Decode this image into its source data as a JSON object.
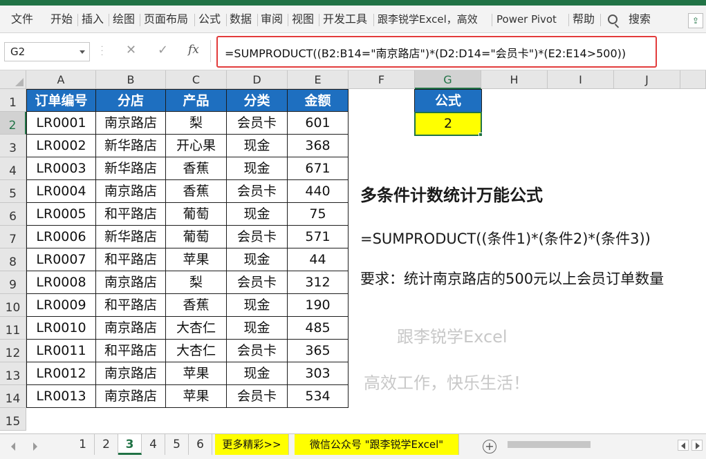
{
  "ribbon": {
    "tabs": [
      "文件",
      "开始",
      "插入",
      "绘图",
      "页面布局",
      "公式",
      "数据",
      "审阅",
      "视图",
      "开发工具",
      "跟李锐学Excel，高效",
      "Power Pivot",
      "帮助"
    ],
    "search_label": "搜索"
  },
  "formula_bar": {
    "name_box": "G2",
    "cancel_glyph": "✕",
    "enter_glyph": "✓",
    "fx_label": "fx",
    "formula": "=SUMPRODUCT((B2:B14=\"南京路店\")*(D2:D14=\"会员卡\")*(E2:E14>500))"
  },
  "columns": [
    "A",
    "B",
    "C",
    "D",
    "E",
    "F",
    "G",
    "H",
    "I",
    "J"
  ],
  "rows": [
    "1",
    "2",
    "3",
    "4",
    "5",
    "6",
    "7",
    "8",
    "9",
    "10",
    "11",
    "12",
    "13",
    "14",
    "15"
  ],
  "table": {
    "headers": [
      "订单编号",
      "分店",
      "产品",
      "分类",
      "金额"
    ],
    "rows": [
      [
        "LR0001",
        "南京路店",
        "梨",
        "会员卡",
        "601"
      ],
      [
        "LR0002",
        "新华路店",
        "开心果",
        "现金",
        "368"
      ],
      [
        "LR0003",
        "新华路店",
        "香蕉",
        "现金",
        "671"
      ],
      [
        "LR0004",
        "南京路店",
        "香蕉",
        "会员卡",
        "440"
      ],
      [
        "LR0005",
        "和平路店",
        "葡萄",
        "现金",
        "75"
      ],
      [
        "LR0006",
        "新华路店",
        "葡萄",
        "会员卡",
        "571"
      ],
      [
        "LR0007",
        "和平路店",
        "苹果",
        "现金",
        "44"
      ],
      [
        "LR0008",
        "南京路店",
        "梨",
        "会员卡",
        "312"
      ],
      [
        "LR0009",
        "和平路店",
        "香蕉",
        "现金",
        "190"
      ],
      [
        "LR0010",
        "南京路店",
        "大杏仁",
        "现金",
        "485"
      ],
      [
        "LR0011",
        "和平路店",
        "大杏仁",
        "会员卡",
        "365"
      ],
      [
        "LR0012",
        "南京路店",
        "苹果",
        "现金",
        "303"
      ],
      [
        "LR0013",
        "南京路店",
        "苹果",
        "会员卡",
        "534"
      ]
    ]
  },
  "result": {
    "header": "公式",
    "value": "2"
  },
  "notes": {
    "title": "多条件计数统计万能公式",
    "generic_formula": "=SUMPRODUCT((条件1)*(条件2)*(条件3))",
    "requirement": "要求：统计南京路店的500元以上会员订单数量",
    "watermark_1": "跟李锐学Excel",
    "watermark_2": "高效工作，快乐生活！"
  },
  "sheet_tabs": {
    "tabs": [
      "1",
      "2",
      "3",
      "4",
      "5",
      "6"
    ],
    "active": "3",
    "extra": [
      "更多精彩>>",
      "微信公众号 \"跟李锐学Excel\""
    ],
    "add_glyph": "+"
  },
  "colors": {
    "excel_green": "#217346",
    "header_blue": "#1e6fc0",
    "highlight_yellow": "#ffff00",
    "annotation_red": "#e23b3b"
  }
}
